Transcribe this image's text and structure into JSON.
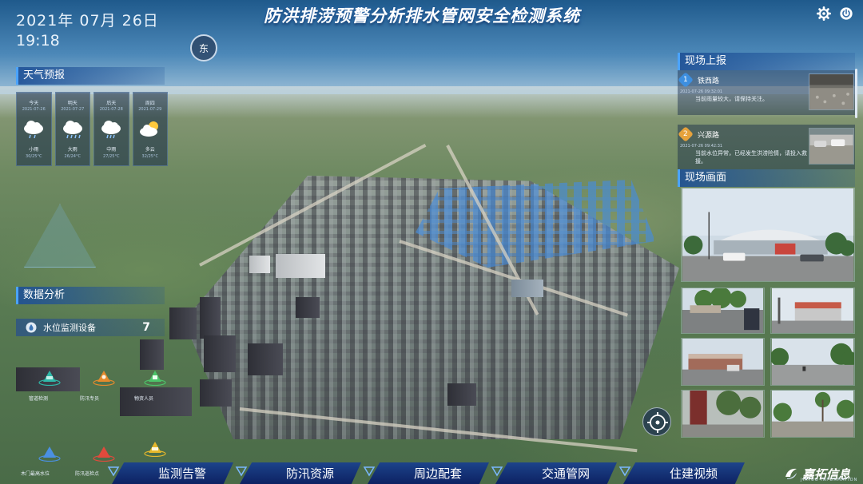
{
  "header": {
    "date": "2021年 07月 26日",
    "time": "19:18",
    "title": "防洪排涝预警分析排水管网安全检测系统",
    "compass": "东",
    "settings_icon": "gear-icon",
    "power_icon": "power-icon"
  },
  "weather": {
    "heading": "天气预报",
    "days": [
      {
        "day": "今天",
        "date": "2021-07-26",
        "condition": "小雨",
        "temp": "30/25°C",
        "icon": "rain-icon"
      },
      {
        "day": "明天",
        "date": "2021-07-27",
        "condition": "大雨",
        "temp": "26/24°C",
        "icon": "heavy-rain-icon"
      },
      {
        "day": "后天",
        "date": "2021-07-28",
        "condition": "中雨",
        "temp": "27/25°C",
        "icon": "rain-icon"
      },
      {
        "day": "周四",
        "date": "2021-07-29",
        "condition": "多云",
        "temp": "32/25°C",
        "icon": "cloudy-icon"
      }
    ]
  },
  "data_analysis": {
    "heading": "数据分析",
    "water_device_label": "水位监测设备",
    "water_device_count": "7",
    "markers": [
      {
        "label": "管道检测",
        "color": "#2fb8a8"
      },
      {
        "label": "防汛专员",
        "color": "#e58a2c"
      },
      {
        "label": "物资人员",
        "color": "#4cc46a"
      },
      {
        "label": "木门最高水位",
        "color": "#4a90e2"
      },
      {
        "label": "防汛巡检点",
        "color": "#e04a3c"
      },
      {
        "label": "",
        "color": "#e5b82c"
      }
    ]
  },
  "site_reports": {
    "heading": "现场上报",
    "items": [
      {
        "num": "1",
        "place": "铁西路",
        "time": "2021-07-26 09:32:01",
        "message": "当前雨量较大，请保持关注。",
        "num_color": "#3d8fe0"
      },
      {
        "num": "2",
        "place": "兴源路",
        "time": "2021-07-26 09:42:31",
        "message": "当前水位异常，已经发生洪涝险情，请投入救援。",
        "num_color": "#e6a23c"
      }
    ]
  },
  "site_video": {
    "heading": "现场画面"
  },
  "nav": {
    "tabs": [
      "监测告警",
      "防汛资源",
      "周边配套",
      "交通管网",
      "住建视频"
    ]
  },
  "brand": {
    "name": "嘉拓信息",
    "sub": "JIATUO INFORMATION"
  },
  "colors": {
    "accent": "#4aa3ff",
    "panel": "#1e5096"
  }
}
